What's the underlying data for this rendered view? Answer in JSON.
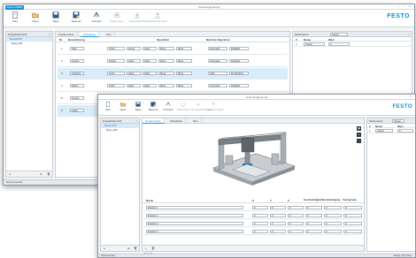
{
  "colors": {
    "accent": "#1f8fd6",
    "brand": "#0091dc",
    "highlight": "#d9ecfa"
  },
  "app": {
    "title": "Festo Engineering",
    "tab": "Festo OVEM",
    "brand": "FESTO",
    "window_controls": "– ▫ ×"
  },
  "ribbon": {
    "buttons": [
      {
        "label": "Neu",
        "icon": "new-file-icon"
      },
      {
        "label": "Open",
        "icon": "open-folder-icon"
      },
      {
        "label": "Save",
        "icon": "save-icon"
      },
      {
        "label": "Save as",
        "icon": "save-as-icon"
      },
      {
        "label": "Connect",
        "icon": "connect-icon"
      },
      {
        "label": "Disconnect",
        "icon": "disconnect-icon"
      },
      {
        "label": "Download Project",
        "icon": "download-icon"
      },
      {
        "label": "Upload Project",
        "icon": "upload-icon"
      }
    ]
  },
  "back": {
    "project_panel": {
      "title": "Projektübersicht",
      "items": [
        "Nexus100",
        "New_001"
      ]
    },
    "tabs": [
      "Positionsliste",
      "Ablaufplan",
      "Text"
    ],
    "columns": [
      "Nr.",
      "Bezeichnung",
      "Operation",
      "Nächste Operation"
    ],
    "rows": [
      {
        "nr": "1",
        "name": "Start",
        "op1": "Ventil",
        "op2": "Home",
        "op3": "Hand",
        "op4": "Mess",
        "op5": "Mess",
        "next1": "Automatic",
        "next2": "Disabled"
      },
      {
        "nr": "2",
        "name": "Greifen",
        "op1": "Greifer",
        "op2": "Hand",
        "op3": "Hand",
        "op4": "Mess",
        "op5": "Mess",
        "next1": "Automatic",
        "next2": "Disabled"
      },
      {
        "nr": "3",
        "name": "Schieben",
        "op1": "Ventil",
        "op2": "Hand",
        "op3": "Hand",
        "op4": "Mess",
        "op5": "Mess",
        "next1": "Hold",
        "next2": "60 Disabled"
      },
      {
        "nr": "4",
        "name": "Heben",
        "op1": "Ventil",
        "op2": "Hand",
        "op3": "Hand",
        "op4": "Mess",
        "op5": "Mess",
        "next1": "Automatic",
        "next2": "Disabled"
      },
      {
        "nr": "5",
        "name": "Senken",
        "op1": "Ventil",
        "op2": "Hand",
        "op3": "Hand",
        "op4": "Mess",
        "op5": "Mess",
        "next1": "Automatic",
        "next2": "Disabled"
      },
      {
        "nr": "6",
        "name": "Laden",
        "op1": "Ventil",
        "op2": "Hand",
        "op3": "Hand",
        "op4": "Mess",
        "op5": "Mess",
        "next1": "Automatic",
        "next2": "Disabled"
      }
    ],
    "params_panel": {
      "title": "Parameters",
      "filter": "Integer",
      "col_name": "Name",
      "col_value": "Wert",
      "row": {
        "nr": "1",
        "name": "Integer",
        "value": "0"
      }
    },
    "status_left": "Disconnected",
    "status_right": "Ready"
  },
  "front": {
    "project_panel": {
      "title": "Projektübersicht",
      "items": [
        "Nexus100",
        "New_001"
      ]
    },
    "tabs": [
      "Positionsliste",
      "Ablaufplan",
      "Text"
    ],
    "columns": [
      "Name",
      "X",
      "Y",
      "Z",
      "Geschwindigkeit",
      "Beschleunigung",
      "Verzögerung"
    ],
    "rows": [
      {
        "name": "Position 1",
        "x": "0",
        "y": "0",
        "z": "0",
        "v": "0",
        "a": "0",
        "d": "0"
      },
      {
        "name": "Position 2",
        "x": "0",
        "y": "0",
        "z": "0",
        "v": "0",
        "a": "0",
        "d": "0"
      },
      {
        "name": "Position 3",
        "x": "0",
        "y": "0",
        "z": "0",
        "v": "0",
        "a": "0",
        "d": "0"
      },
      {
        "name": "Position 4",
        "x": "0",
        "y": "0",
        "z": "0",
        "v": "0",
        "a": "0",
        "d": "0"
      }
    ],
    "params_panel": {
      "title": "Parameters",
      "filter": "Integer",
      "col_name": "Name",
      "col_value": "Wert",
      "row": {
        "nr": "1",
        "name": "Integer",
        "value": "0"
      }
    },
    "bottom_tab": "Export",
    "status_left": "Disconnected",
    "status_right": "Ready  |  Cfg  |  Rev"
  }
}
